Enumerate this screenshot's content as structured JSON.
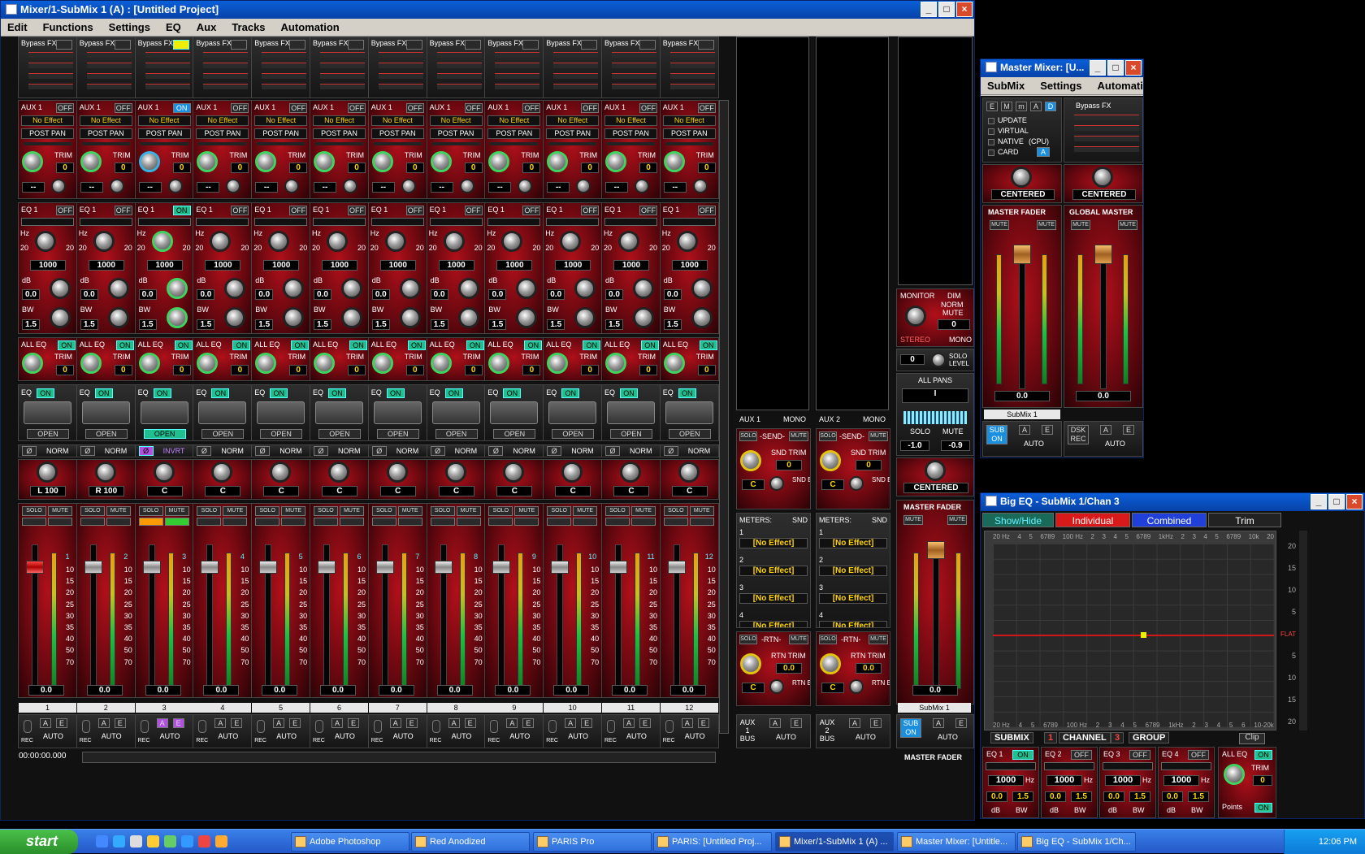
{
  "mixer": {
    "title": "Mixer/1-SubMix 1 (A) : [Untitled Project]",
    "menu": [
      "Edit",
      "Functions",
      "Settings",
      "EQ",
      "Aux",
      "Tracks",
      "Automation"
    ],
    "channels": [
      {
        "num": "1",
        "pan": "L 100",
        "eq": "1000",
        "aux": "OFF",
        "eqb": "OFF",
        "phase": "NORM",
        "fx_active": false,
        "fader": "0.0"
      },
      {
        "num": "2",
        "pan": "R 100",
        "eq": "1000",
        "aux": "OFF",
        "eqb": "OFF",
        "phase": "NORM",
        "fx_active": false,
        "fader": "0.0"
      },
      {
        "num": "3",
        "pan": "C",
        "eq": "1000",
        "aux": "ON",
        "eqb": "ON",
        "phase": "INVRT",
        "fx_active": true,
        "fader": "0.0"
      },
      {
        "num": "4",
        "pan": "C",
        "eq": "1000",
        "aux": "OFF",
        "eqb": "OFF",
        "phase": "NORM",
        "fx_active": false,
        "fader": "0.0"
      },
      {
        "num": "5",
        "pan": "C",
        "eq": "1000",
        "aux": "OFF",
        "eqb": "OFF",
        "phase": "NORM",
        "fx_active": false,
        "fader": "0.0"
      },
      {
        "num": "6",
        "pan": "C",
        "eq": "1000",
        "aux": "OFF",
        "eqb": "OFF",
        "phase": "NORM",
        "fx_active": false,
        "fader": "0.0"
      },
      {
        "num": "7",
        "pan": "C",
        "eq": "1000",
        "aux": "OFF",
        "eqb": "OFF",
        "phase": "NORM",
        "fx_active": false,
        "fader": "0.0"
      },
      {
        "num": "8",
        "pan": "C",
        "eq": "1000",
        "aux": "OFF",
        "eqb": "OFF",
        "phase": "NORM",
        "fx_active": false,
        "fader": "0.0"
      },
      {
        "num": "9",
        "pan": "C",
        "eq": "1000",
        "aux": "OFF",
        "eqb": "OFF",
        "phase": "NORM",
        "fx_active": false,
        "fader": "0.0"
      },
      {
        "num": "10",
        "pan": "C",
        "eq": "1000",
        "aux": "OFF",
        "eqb": "OFF",
        "phase": "NORM",
        "fx_active": false,
        "fader": "0.0"
      },
      {
        "num": "11",
        "pan": "C",
        "eq": "1000",
        "aux": "OFF",
        "eqb": "OFF",
        "phase": "NORM",
        "fx_active": false,
        "fader": "0.0"
      },
      {
        "num": "12",
        "pan": "C",
        "eq": "1000",
        "aux": "OFF",
        "eqb": "OFF",
        "phase": "NORM",
        "fx_active": false,
        "fader": "0.0"
      }
    ],
    "labels": {
      "bypass": "Bypass FX",
      "aux": "AUX 1",
      "no_effect": "No Effect",
      "post_pan": "POST PAN",
      "trim": "TRIM",
      "eq1": "EQ 1",
      "hz": "Hz",
      "db": "dB",
      "bw": "BW",
      "twenty": "20",
      "dbv": "0.0",
      "bwv": "1.5",
      "alleq": "ALL EQ",
      "on": "ON",
      "eq": "EQ",
      "open": "OPEN",
      "phi": "Ø",
      "solo": "SOLO",
      "mute": "MUTE",
      "rec": "REC",
      "a": "A",
      "e": "E",
      "auto": "AUTO",
      "zero": "0",
      "dash": "--"
    },
    "scale": [
      "1",
      "10",
      "15",
      "20",
      "25",
      "30",
      "35",
      "40",
      "50",
      "70"
    ],
    "time": "00:00:00.000",
    "aux_buses": [
      {
        "label": "AUX 1",
        "mono": "MONO",
        "bus": "AUX 1 BUS"
      },
      {
        "label": "AUX 2",
        "mono": "MONO",
        "bus": "AUX 2 BUS"
      }
    ],
    "bus_labels": {
      "send": "-SEND-",
      "snd_trim": "SND TRIM",
      "snd_bal": "SND BAL",
      "rtn": "-RTN-",
      "rtn_trim": "RTN TRIM",
      "rtn_bal": "RTN BAL",
      "meters": "METERS:",
      "snd": "SND",
      "c": "C",
      "bus_no_effect": "[No Effect]",
      "rtn_val": "0.0"
    },
    "monitor": {
      "label": "MONITOR",
      "dim": "DIM",
      "norm": "NORM",
      "mute": "MUTE",
      "value": "0",
      "stereo": "STEREO",
      "mono": "MONO",
      "solo_level": "SOLO LEVEL",
      "all_pans": "ALL PANS",
      "pan_value": "I",
      "solo": "SOLO",
      "solo_val": "-1.0",
      "mute_val": "-0.9",
      "centered": "CENTERED",
      "master_fader": "MASTER FADER",
      "fader_val": "0.0",
      "submix": "SubMix 1",
      "sub_on": "SUB ON",
      "footer": "MASTER FADER"
    }
  },
  "master": {
    "title": "Master Mixer: [U...",
    "menu": [
      "SubMix",
      "Settings",
      "Automation"
    ],
    "modes": [
      "E",
      "M",
      "m",
      "A",
      "D"
    ],
    "options": [
      "UPDATE",
      "VIRTUAL",
      "NATIVE",
      "CARD"
    ],
    "cpu": "(CPU)",
    "card_val": "A",
    "bypass": "Bypass FX",
    "centered": "CENTERED",
    "mf": "MASTER FADER",
    "gm": "GLOBAL MASTER",
    "mute": "MUTE",
    "val": "0.0",
    "submix": "SubMix 1",
    "sub_on": "SUB ON",
    "dsk_rec": "DSK REC",
    "a": "A",
    "e": "E",
    "auto": "AUTO"
  },
  "bigeq": {
    "title": "Big EQ - SubMix 1/Chan 3",
    "tabs": [
      "Show/Hide",
      "Individual",
      "Combined",
      "Trim"
    ],
    "freqs": [
      "20 Hz",
      "4",
      "5",
      "6789",
      "100 Hz",
      "2",
      "3",
      "4",
      "5",
      "6789",
      "1kHz",
      "2",
      "3",
      "4",
      "5",
      "6789",
      "10k",
      "20"
    ],
    "freqs_bottom": [
      "20 Hz",
      "4",
      "5",
      "6789",
      "100 Hz",
      "2",
      "3",
      "4",
      "5",
      "6789",
      "1kHz",
      "2",
      "3",
      "4",
      "5",
      "6",
      "10-20k"
    ],
    "db_scale": [
      "20",
      "15",
      "10",
      "5",
      "FLAT",
      "5",
      "10",
      "15",
      "20"
    ],
    "footer": [
      "SUBMIX",
      "1",
      "CHANNEL",
      "3",
      "GROUP"
    ],
    "clip": "Clip",
    "bands": [
      {
        "n": "EQ 1",
        "s": "ON"
      },
      {
        "n": "EQ 2",
        "s": "OFF"
      },
      {
        "n": "EQ 3",
        "s": "OFF"
      },
      {
        "n": "EQ 4",
        "s": "OFF"
      }
    ],
    "hz": "Hz",
    "freq": "1000",
    "db": "0.0",
    "bw": "1.5",
    "dbl": "dB",
    "bwl": "BW",
    "alleq": "ALL EQ",
    "on": "ON",
    "trim": "TRIM",
    "trimv": "0",
    "points": "Points"
  },
  "taskbar": {
    "start": "start",
    "tasks": [
      "Adobe Photoshop",
      "Red Anodized",
      "PARIS Pro",
      "PARIS: [Untitled Proj...",
      "Mixer/1-SubMix 1 (A) ...",
      "Master Mixer: [Untitle...",
      "Big EQ - SubMix 1/Ch..."
    ],
    "clock": "12:06 PM"
  }
}
